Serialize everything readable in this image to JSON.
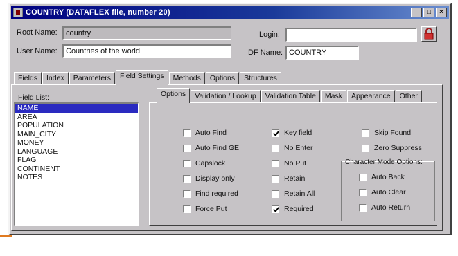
{
  "window": {
    "title": "COUNTRY  (DATAFLEX file, number 20)",
    "controls": [
      "_",
      "□",
      "×"
    ]
  },
  "header": {
    "root_name_label": "Root Name:",
    "root_name_value": "country",
    "user_name_label": "User Name:",
    "user_name_value": "Countries of the world",
    "login_label": "Login:",
    "login_value": "",
    "df_name_label": "DF Name:",
    "df_name_value": "COUNTRY"
  },
  "main_tabs": [
    {
      "label": "Fields"
    },
    {
      "label": "Index"
    },
    {
      "label": "Parameters"
    },
    {
      "label": "Field Settings"
    },
    {
      "label": "Methods"
    },
    {
      "label": "Options"
    },
    {
      "label": "Structures"
    }
  ],
  "field_list": {
    "label": "Field List:",
    "items": [
      "NAME",
      "AREA",
      "POPULATION",
      "MAIN_CITY",
      "MONEY",
      "LANGUAGE",
      "FLAG",
      "CONTINENT",
      "NOTES"
    ],
    "selected": "NAME"
  },
  "sub_tabs": [
    {
      "label": "Options"
    },
    {
      "label": "Validation / Lookup"
    },
    {
      "label": "Validation Table"
    },
    {
      "label": "Mask"
    },
    {
      "label": "Appearance"
    },
    {
      "label": "Other"
    }
  ],
  "options": {
    "col1": [
      {
        "label": "Auto Find",
        "checked": false
      },
      {
        "label": "Auto Find GE",
        "checked": false
      },
      {
        "label": "Capslock",
        "checked": false
      },
      {
        "label": "Display only",
        "checked": false
      },
      {
        "label": "Find required",
        "checked": false
      },
      {
        "label": "Force Put",
        "checked": false
      }
    ],
    "col2": [
      {
        "label": "Key field",
        "checked": true
      },
      {
        "label": "No Enter",
        "checked": false
      },
      {
        "label": "No Put",
        "checked": false
      },
      {
        "label": "Retain",
        "checked": false
      },
      {
        "label": "Retain All",
        "checked": false
      },
      {
        "label": "Required",
        "checked": true
      }
    ],
    "col3": [
      {
        "label": "Skip Found",
        "checked": false
      },
      {
        "label": "Zero Suppress",
        "checked": false
      }
    ],
    "char_mode_label": "Character Mode Options:",
    "char_mode": [
      {
        "label": "Auto Back",
        "checked": false
      },
      {
        "label": "Auto Clear",
        "checked": false
      },
      {
        "label": "Auto Return",
        "checked": false
      }
    ]
  },
  "colors": {
    "title_bar": "#000080",
    "selection": "#2a2ac0",
    "face": "#c6c3c6"
  }
}
